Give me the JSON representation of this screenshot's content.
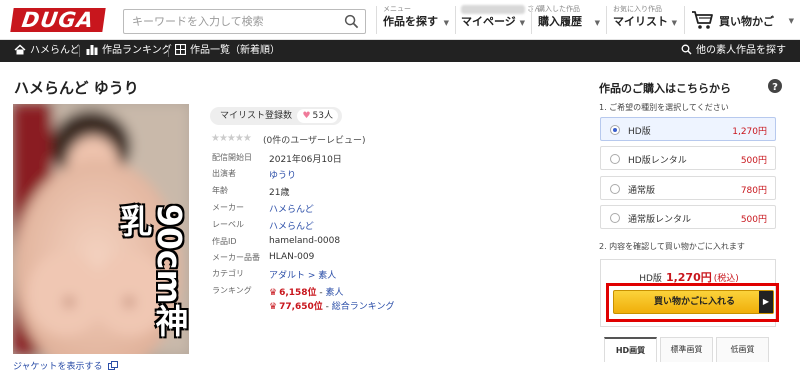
{
  "brand": {
    "logo_text": "DUGA",
    "accent": "#c8161d"
  },
  "search": {
    "placeholder": "キーワードを入力して検索",
    "icon": "search-icon"
  },
  "header_nav": {
    "find": {
      "small": "メニュー",
      "label": "作品を探す"
    },
    "mypage": {
      "small_suffix": "さん",
      "label": "マイページ"
    },
    "history": {
      "small": "購入した作品",
      "label": "購入履歴"
    },
    "mylist": {
      "small": "お気に入り作品",
      "label": "マイリスト"
    },
    "cart": {
      "label": "買い物かご",
      "icon": "cart-icon"
    }
  },
  "subnav": {
    "items": [
      {
        "label": "ハメらんど",
        "icon": "home-icon"
      },
      {
        "label": "作品ランキング",
        "icon": "ranking-icon"
      },
      {
        "label": "作品一覧（新着順）",
        "icon": "list-icon"
      }
    ],
    "right": {
      "label": "他の素人作品を探す",
      "icon": "search-icon"
    }
  },
  "product": {
    "title": "ハメらんど ゆうり",
    "jacket_caption": "90cm神乳",
    "jacket_link": "ジャケットを表示する",
    "mylist_label": "マイリスト登録数",
    "mylist_count": "53人",
    "rating_stars": "★★★★★",
    "review_text": "(0件のユーザーレビュー)",
    "specs": [
      {
        "key": "配信開始日",
        "value": "2021年06月10日"
      },
      {
        "key": "出演者",
        "value": "ゆうり"
      },
      {
        "key": "年齢",
        "value": "21歳"
      },
      {
        "key": "メーカー",
        "value": "ハメらんど"
      },
      {
        "key": "レーベル",
        "value": "ハメらんど"
      },
      {
        "key": "作品ID",
        "value": "hameland-0008"
      },
      {
        "key": "メーカー品番",
        "value": "HLAN-009"
      },
      {
        "key": "カテゴリ",
        "value": "アダルト > 素人"
      },
      {
        "key": "ランキング",
        "value": ""
      }
    ],
    "ranking": [
      {
        "rank": "6,158位",
        "sep": " - ",
        "label": "素人"
      },
      {
        "rank": "77,650位",
        "sep": " - ",
        "label": "総合ランキング"
      }
    ]
  },
  "purchase": {
    "title": "作品のご購入はこちらから",
    "step1": "1. ご希望の種別を選択してください",
    "options": [
      {
        "name": "HD版",
        "price": "1,270円",
        "selected": true
      },
      {
        "name": "HD版レンタル",
        "price": "500円",
        "selected": false
      },
      {
        "name": "通常版",
        "price": "780円",
        "selected": false
      },
      {
        "name": "通常版レンタル",
        "price": "500円",
        "selected": false
      }
    ],
    "step2": "2. 内容を確認して買い物かごに入れます",
    "summary_label": "HD版",
    "summary_price": "1,270円",
    "summary_tax": "(税込)",
    "cart_button": "買い物かごに入れる",
    "tabs": [
      "HD画質",
      "標準画質",
      "低画質"
    ],
    "active_tab": 0
  }
}
